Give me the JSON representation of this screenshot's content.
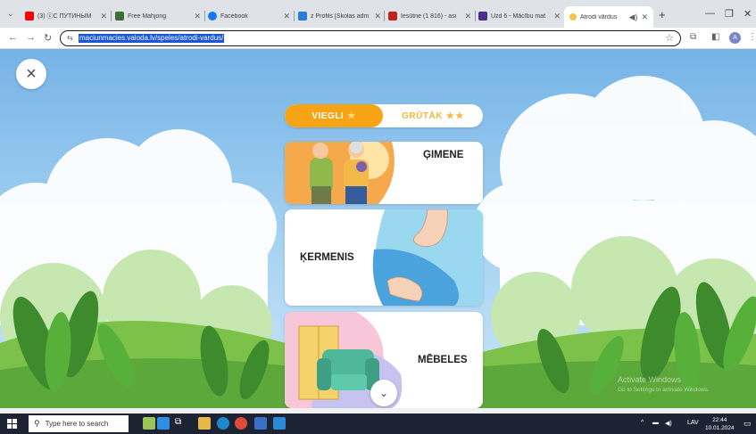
{
  "browser": {
    "tabs": [
      {
        "title": "(3) ⓒC ПУТИНЫМ",
        "color": "#ff0000"
      },
      {
        "title": "Free Mahjong",
        "color": "#3b6e3b"
      },
      {
        "title": "Facebook",
        "color": "#1877f2"
      },
      {
        "title": "z Profils [Skolas adm",
        "color": "#2b7bd8"
      },
      {
        "title": "Iesūtne (1 816) - asi",
        "color": "#c5221f"
      },
      {
        "title": "Uzd 6 - Mācību mat",
        "color": "#4b2f8a"
      },
      {
        "title": "Atrodi vārdus",
        "color": "#f6c343"
      }
    ],
    "address": "maciunmacies.valoda.lv/speles/atrodi-vardus/",
    "profile_letter": "A"
  },
  "game": {
    "close_glyph": "×",
    "difficulty": {
      "easy_label": "VIEGLI",
      "hard_label": "GRŪTĀK",
      "star": "★",
      "selected": "easy"
    },
    "categories": [
      {
        "label": "ĢIMENE"
      },
      {
        "label": "ĶERMENIS"
      },
      {
        "label": "MĒBELES"
      }
    ],
    "scroll_glyph": "⌄"
  },
  "watermark": {
    "line1": "Activate Windows",
    "line2": "Go to Settings to activate Windows."
  },
  "taskbar": {
    "search_placeholder": "Type here to search",
    "language": "LAV",
    "time": "22:44",
    "date": "10.01.2024"
  }
}
